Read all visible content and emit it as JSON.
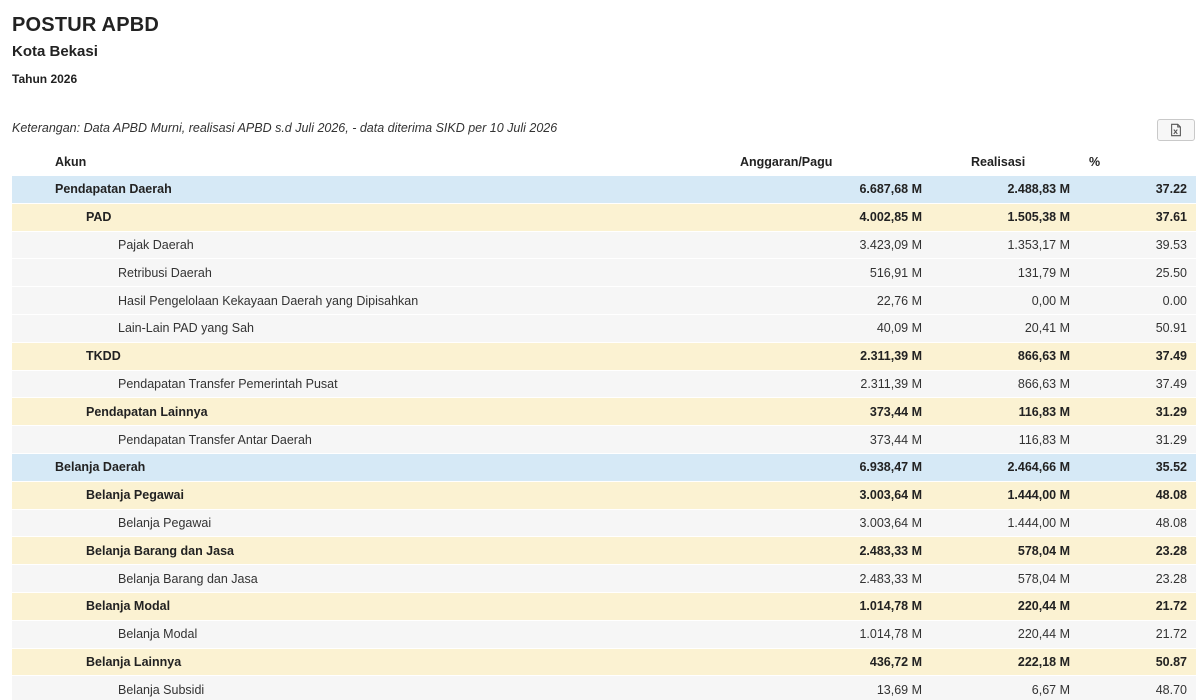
{
  "header": {
    "title": "POSTUR APBD",
    "subtitle": "Kota Bekasi",
    "year": "Tahun 2026",
    "note": "Keterangan: Data APBD Murni, realisasi APBD s.d Juli 2026, - data diterima SIKD per 10 Juli 2026",
    "export_icon": "excel-export-icon"
  },
  "table": {
    "columns": {
      "akun": "Akun",
      "anggaran": "Anggaran/Pagu",
      "realisasi": "Realisasi",
      "persen": "%"
    },
    "rows": [
      {
        "level": 0,
        "akun": "Pendapatan Daerah",
        "anggaran": "6.687,68 M",
        "realisasi": "2.488,83 M",
        "persen": "37.22"
      },
      {
        "level": 1,
        "akun": "PAD",
        "anggaran": "4.002,85 M",
        "realisasi": "1.505,38 M",
        "persen": "37.61"
      },
      {
        "level": 2,
        "akun": "Pajak Daerah",
        "anggaran": "3.423,09 M",
        "realisasi": "1.353,17 M",
        "persen": "39.53"
      },
      {
        "level": 2,
        "akun": "Retribusi Daerah",
        "anggaran": "516,91 M",
        "realisasi": "131,79 M",
        "persen": "25.50"
      },
      {
        "level": 2,
        "akun": "Hasil Pengelolaan Kekayaan Daerah yang Dipisahkan",
        "anggaran": "22,76 M",
        "realisasi": "0,00 M",
        "persen": "0.00"
      },
      {
        "level": 2,
        "akun": "Lain-Lain PAD yang Sah",
        "anggaran": "40,09 M",
        "realisasi": "20,41 M",
        "persen": "50.91"
      },
      {
        "level": 1,
        "akun": "TKDD",
        "anggaran": "2.311,39 M",
        "realisasi": "866,63 M",
        "persen": "37.49"
      },
      {
        "level": 2,
        "akun": "Pendapatan Transfer Pemerintah Pusat",
        "anggaran": "2.311,39 M",
        "realisasi": "866,63 M",
        "persen": "37.49"
      },
      {
        "level": 1,
        "akun": "Pendapatan Lainnya",
        "anggaran": "373,44 M",
        "realisasi": "116,83 M",
        "persen": "31.29"
      },
      {
        "level": 2,
        "akun": "Pendapatan Transfer Antar Daerah",
        "anggaran": "373,44 M",
        "realisasi": "116,83 M",
        "persen": "31.29"
      },
      {
        "level": 0,
        "akun": "Belanja Daerah",
        "anggaran": "6.938,47 M",
        "realisasi": "2.464,66 M",
        "persen": "35.52"
      },
      {
        "level": 1,
        "akun": "Belanja Pegawai",
        "anggaran": "3.003,64 M",
        "realisasi": "1.444,00 M",
        "persen": "48.08"
      },
      {
        "level": 2,
        "akun": "Belanja Pegawai",
        "anggaran": "3.003,64 M",
        "realisasi": "1.444,00 M",
        "persen": "48.08"
      },
      {
        "level": 1,
        "akun": "Belanja Barang dan Jasa",
        "anggaran": "2.483,33 M",
        "realisasi": "578,04 M",
        "persen": "23.28"
      },
      {
        "level": 2,
        "akun": "Belanja Barang dan Jasa",
        "anggaran": "2.483,33 M",
        "realisasi": "578,04 M",
        "persen": "23.28"
      },
      {
        "level": 1,
        "akun": "Belanja Modal",
        "anggaran": "1.014,78 M",
        "realisasi": "220,44 M",
        "persen": "21.72"
      },
      {
        "level": 2,
        "akun": "Belanja Modal",
        "anggaran": "1.014,78 M",
        "realisasi": "220,44 M",
        "persen": "21.72"
      },
      {
        "level": 1,
        "akun": "Belanja Lainnya",
        "anggaran": "436,72 M",
        "realisasi": "222,18 M",
        "persen": "50.87"
      },
      {
        "level": 2,
        "akun": "Belanja Subsidi",
        "anggaran": "13,69 M",
        "realisasi": "6,67 M",
        "persen": "48.70"
      }
    ]
  },
  "colors": {
    "level0_bg": "#d6e9f6",
    "level1_bg": "#fbf2d2",
    "level2_bg": "#f6f6f6",
    "excel_icon": "#555555"
  }
}
